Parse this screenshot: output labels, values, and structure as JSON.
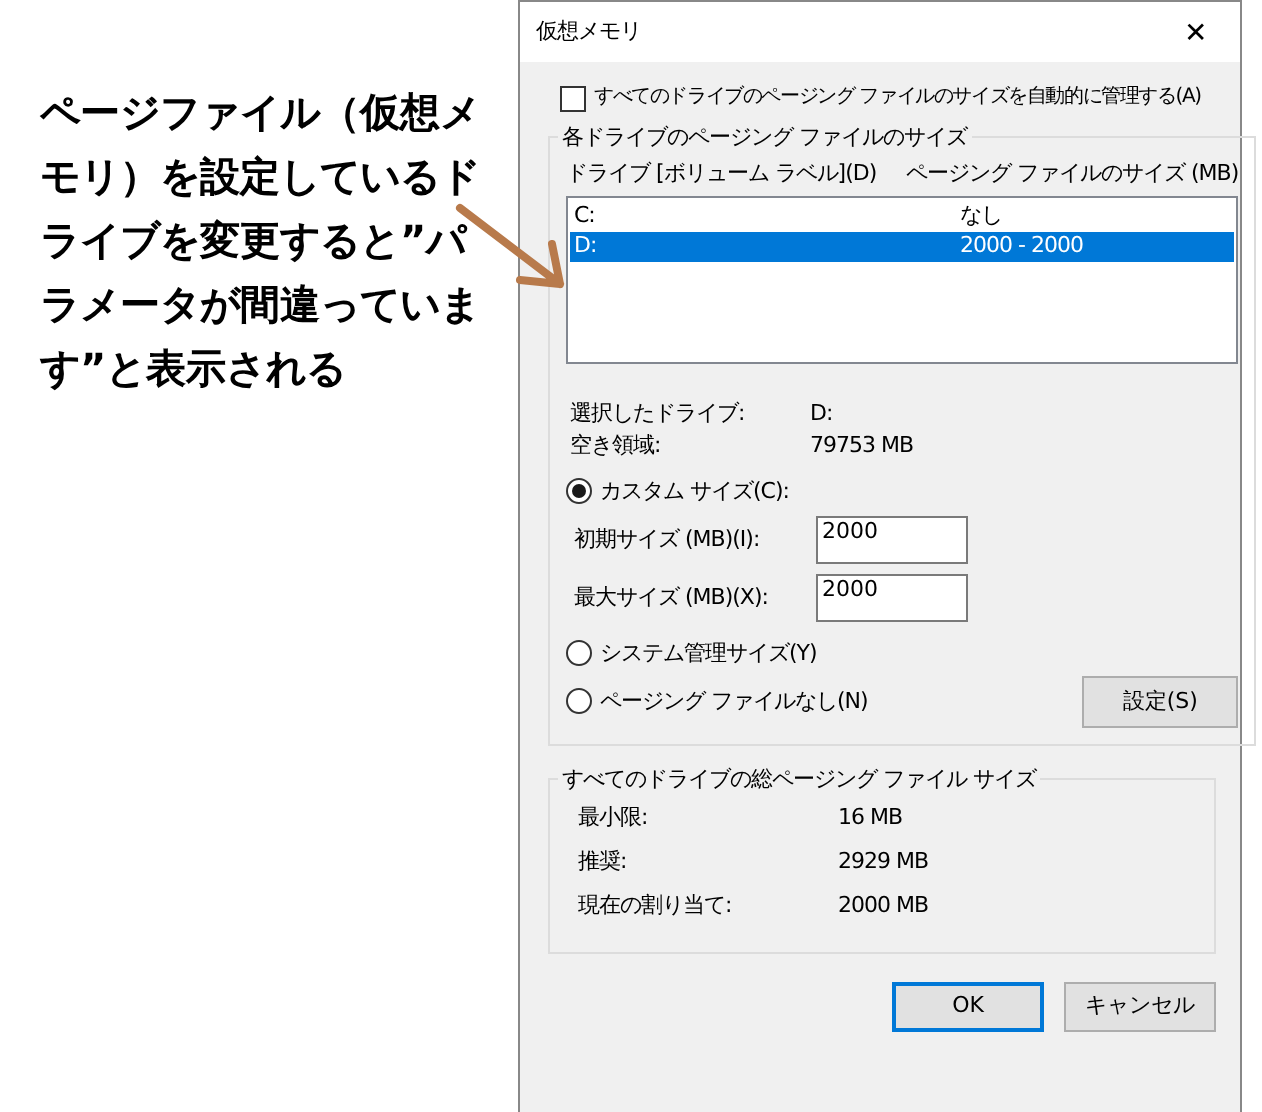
{
  "annotation": "ページファイル（仮想メモリ）を設定しているドライブを変更すると”パラメータが間違っています”と表示される",
  "window": {
    "title": "仮想メモリ",
    "close": "✕"
  },
  "auto_manage": {
    "label": "すべてのドライブのページング ファイルのサイズを自動的に管理する(A)",
    "checked": false
  },
  "drives_group": {
    "title": "各ドライブのページング ファイルのサイズ",
    "columns": [
      "ドライブ [ボリューム ラベル](D)",
      "ページング ファイルのサイズ (MB)"
    ],
    "rows": [
      {
        "drive": "C:",
        "size": "なし",
        "selected": false
      },
      {
        "drive": "D:",
        "size": "2000 - 2000",
        "selected": true
      }
    ],
    "info": [
      {
        "label": "選択したドライブ:",
        "value": "D:"
      },
      {
        "label": "空き領域:",
        "value": "79753 MB"
      }
    ],
    "options": [
      {
        "kind": "custom",
        "label": "カスタム サイズ(C):",
        "selected": true,
        "fields": [
          {
            "label": "初期サイズ (MB)(I):",
            "value": "2000"
          },
          {
            "label": "最大サイズ (MB)(X):",
            "value": "2000"
          }
        ]
      },
      {
        "kind": "plain",
        "label": "システム管理サイズ(Y)",
        "selected": false
      },
      {
        "kind": "plain",
        "label": "ページング ファイルなし(N)",
        "selected": false
      }
    ],
    "set_button": "設定(S)"
  },
  "totals_group": {
    "title": "すべてのドライブの総ページング ファイル サイズ",
    "rows": [
      {
        "label": "最小限:",
        "value": "16 MB"
      },
      {
        "label": "推奨:",
        "value": "2929 MB"
      },
      {
        "label": "現在の割り当て:",
        "value": "2000 MB"
      }
    ]
  },
  "buttons": [
    {
      "label": "OK",
      "kind": "default"
    },
    {
      "label": "キャンセル",
      "kind": "normal"
    }
  ]
}
